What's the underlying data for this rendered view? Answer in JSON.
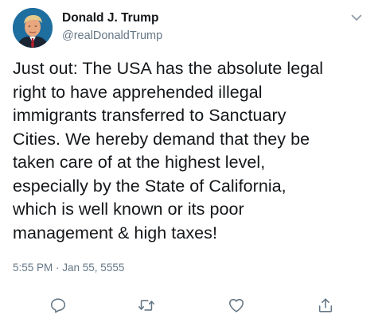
{
  "user": {
    "display_name": "Donald J. Trump",
    "username": "@realDonaldTrump",
    "avatar_icon": "profile-photo"
  },
  "tweet": {
    "text": "Just out: The USA has the absolute legal\nright to have apprehended illegal\nimmigrants transferred to Sanctuary\nCities. We hereby demand that they be\ntaken care of at the highest level,\nespecially by the State of California,\nwhich is well known or its poor\nmanagement & high taxes!",
    "timestamp": "5:55 PM · Jan 55, 5555"
  },
  "actions": {
    "menu_icon": "chevron-down-icon",
    "reply_icon": "reply-icon",
    "retweet_icon": "retweet-icon",
    "like_icon": "heart-icon",
    "share_icon": "share-icon"
  },
  "colors": {
    "text_primary": "#14171a",
    "text_secondary": "#657786",
    "icon_gray": "#657786",
    "background": "#ffffff"
  }
}
